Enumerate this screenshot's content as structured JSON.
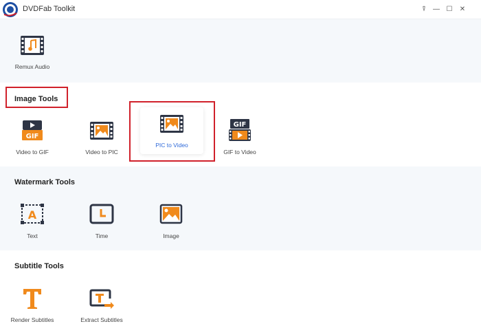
{
  "window": {
    "title": "DVDFab Toolkit",
    "controls": {
      "pin": "⍒",
      "minimize": "—",
      "maximize": "☐",
      "close": "✕"
    }
  },
  "sections": {
    "audio": {
      "tools": [
        {
          "label": "Remux Audio",
          "icon": "music-film-icon"
        }
      ]
    },
    "image": {
      "title": "Image Tools",
      "tools": [
        {
          "label": "Video to GIF",
          "icon": "video-gif-icon"
        },
        {
          "label": "Video to PIC",
          "icon": "film-picture-icon"
        },
        {
          "label": "PIC to Video",
          "icon": "picture-film-icon",
          "selected": true
        },
        {
          "label": "GIF to Video",
          "icon": "gif-film-icon"
        }
      ]
    },
    "watermark": {
      "title": "Watermark Tools",
      "tools": [
        {
          "label": "Text",
          "icon": "text-watermark-icon"
        },
        {
          "label": "Time",
          "icon": "clock-icon"
        },
        {
          "label": "Image",
          "icon": "image-icon"
        }
      ]
    },
    "subtitle": {
      "title": "Subtitle Tools",
      "tools": [
        {
          "label": "Render Subtitles",
          "icon": "render-subtitle-icon"
        },
        {
          "label": "Extract Subtitles",
          "icon": "extract-subtitle-icon"
        }
      ]
    }
  },
  "gif_badge": "GIF",
  "text_badge": "A",
  "colors": {
    "accent": "#f08a1c",
    "dark": "#2e3545",
    "selected_text": "#2f6ad9",
    "highlight_box": "#d0202a"
  }
}
